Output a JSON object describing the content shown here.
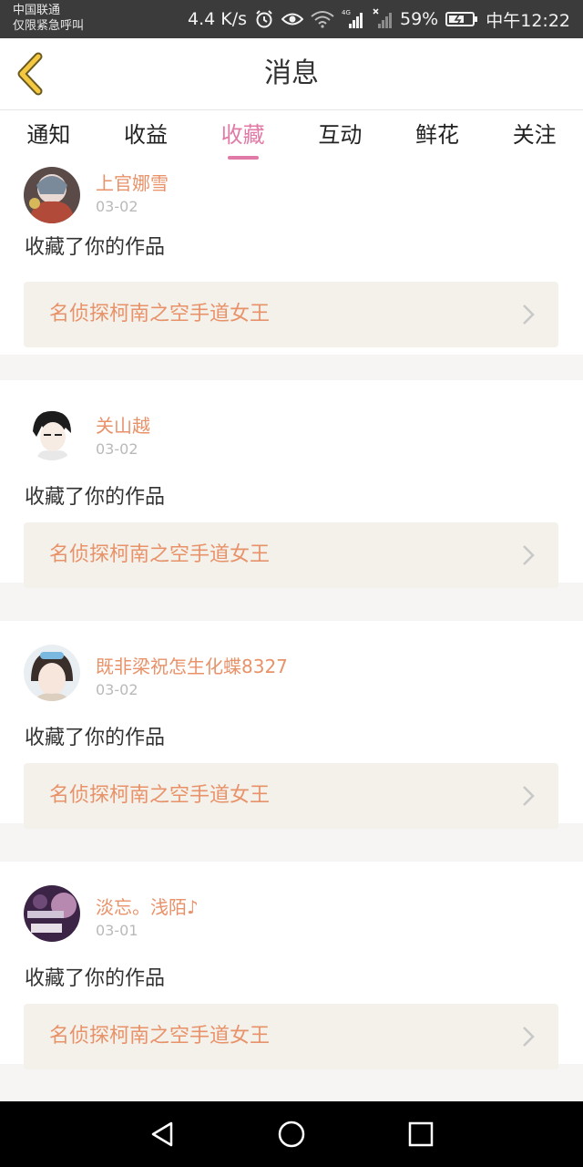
{
  "status_bar": {
    "carrier_line1": "中国联通",
    "carrier_line2": "仅限紧急呼叫",
    "speed": "4.4 K/s",
    "network": "4G",
    "battery": "59%",
    "time": "中午12:22",
    "icons": [
      "alarm-icon",
      "eye-icon",
      "wifi-icon",
      "signal-icon",
      "no-signal-icon",
      "battery-icon"
    ]
  },
  "header": {
    "title": "消息",
    "back_icon": "back-chevron-icon"
  },
  "tabs": [
    {
      "label": "通知",
      "active": false
    },
    {
      "label": "收益",
      "active": false
    },
    {
      "label": "收藏",
      "active": true
    },
    {
      "label": "互动",
      "active": false
    },
    {
      "label": "鲜花",
      "active": false
    },
    {
      "label": "关注",
      "active": false
    }
  ],
  "items": [
    {
      "user": "上官娜雪",
      "date": "03-02",
      "action": "收藏了你的作品",
      "work": "名侦探柯南之空手道女王"
    },
    {
      "user": "关山越",
      "date": "03-02",
      "action": "收藏了你的作品",
      "work": "名侦探柯南之空手道女王"
    },
    {
      "user": "既非梁祝怎生化蝶8327",
      "date": "03-02",
      "action": "收藏了你的作品",
      "work": "名侦探柯南之空手道女王"
    },
    {
      "user": "淡忘。浅陌♪",
      "date": "03-01",
      "action": "收藏了你的作品",
      "work": "名侦探柯南之空手道女王"
    }
  ],
  "colors": {
    "accent_pink": "#e07aa6",
    "username_orange": "#e8926a",
    "work_box_bg": "#f3f1ea",
    "status_bar_bg": "#3b3b3b"
  },
  "nav": {
    "icons": [
      "back-triangle-icon",
      "home-circle-icon",
      "recents-square-icon"
    ]
  }
}
